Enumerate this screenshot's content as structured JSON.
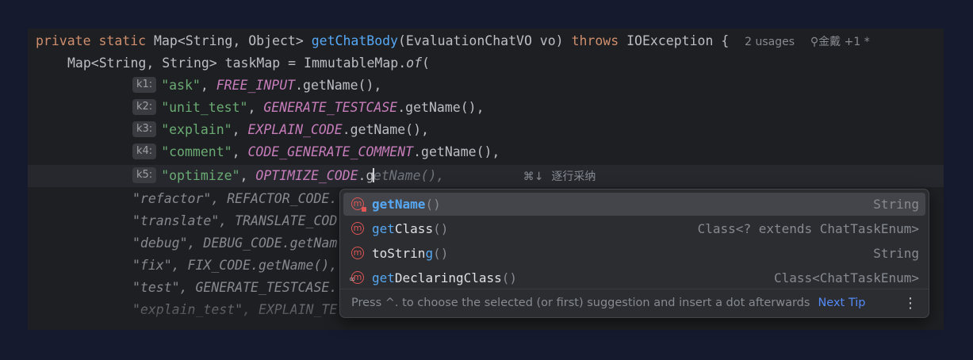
{
  "code": {
    "line1": {
      "mod1": "private",
      "mod2": "static",
      "ret_type": "Map<String, Object>",
      "method": "getChatBody",
      "params": "(EvaluationChatVO vo)",
      "throws_kw": "throws",
      "exception": "IOException {",
      "usages": "2 usages",
      "author": "金戴 +1 *"
    },
    "line2": {
      "decl": "Map<String, String> taskMap = ImmutableMap.",
      "call": "of",
      "open": "("
    },
    "args": [
      {
        "hint": "k1:",
        "key": "\"ask\"",
        "const": "FREE_INPUT",
        "rest": ".getName(),"
      },
      {
        "hint": "k2:",
        "key": "\"unit_test\"",
        "const": "GENERATE_TESTCASE",
        "rest": ".getName(),"
      },
      {
        "hint": "k3:",
        "key": "\"explain\"",
        "const": "EXPLAIN_CODE",
        "rest": ".getName(),"
      },
      {
        "hint": "k4:",
        "key": "\"comment\"",
        "const": "CODE_GENERATE_COMMENT",
        "rest": ".getName(),"
      }
    ],
    "current": {
      "hint": "k5:",
      "key": "\"optimize\"",
      "const": "OPTIMIZE_CODE",
      "typed": ".g",
      "ghost_a": "e",
      "ghost_b": "tName(),",
      "shortcut": "⌘↓",
      "accept_label": "逐行采纳"
    },
    "faded_lines": [
      "\"refactor\", REFACTOR_CODE.",
      "\"translate\", TRANSLATE_COD",
      "\"debug\", DEBUG_CODE.getNam",
      "\"fix\", FIX_CODE.getName(),",
      "\"test\", GENERATE_TESTCASE.",
      "\"explain_test\", EXPLAIN_TE"
    ]
  },
  "completion": {
    "items": [
      {
        "prefix": "get",
        "name": "Name",
        "parens": "()",
        "type": "String",
        "selected": true,
        "icon": "method-icon"
      },
      {
        "prefix": "get",
        "name": "Class",
        "parens": "()",
        "type": "Class<? extends ChatTaskEnum>",
        "selected": false,
        "icon": "method-icon"
      },
      {
        "prefix": "toStrin",
        "name": "g",
        "parens": "()",
        "type": "String",
        "selected": false,
        "icon": "method-icon"
      },
      {
        "prefix": "get",
        "name": "DeclaringClass",
        "parens": "()",
        "type": "Class<ChatTaskEnum>",
        "selected": false,
        "icon": "method-icon"
      }
    ],
    "footer_text": "Press ^. to choose the selected (or first) suggestion and insert a dot afterwards",
    "next_tip": "Next Tip",
    "more": "⋮"
  },
  "colors": {
    "keyword": "#cf8e6d",
    "function": "#56a8f5",
    "string": "#6aab73",
    "constant": "#c77dbb",
    "accent": "#548af7"
  }
}
